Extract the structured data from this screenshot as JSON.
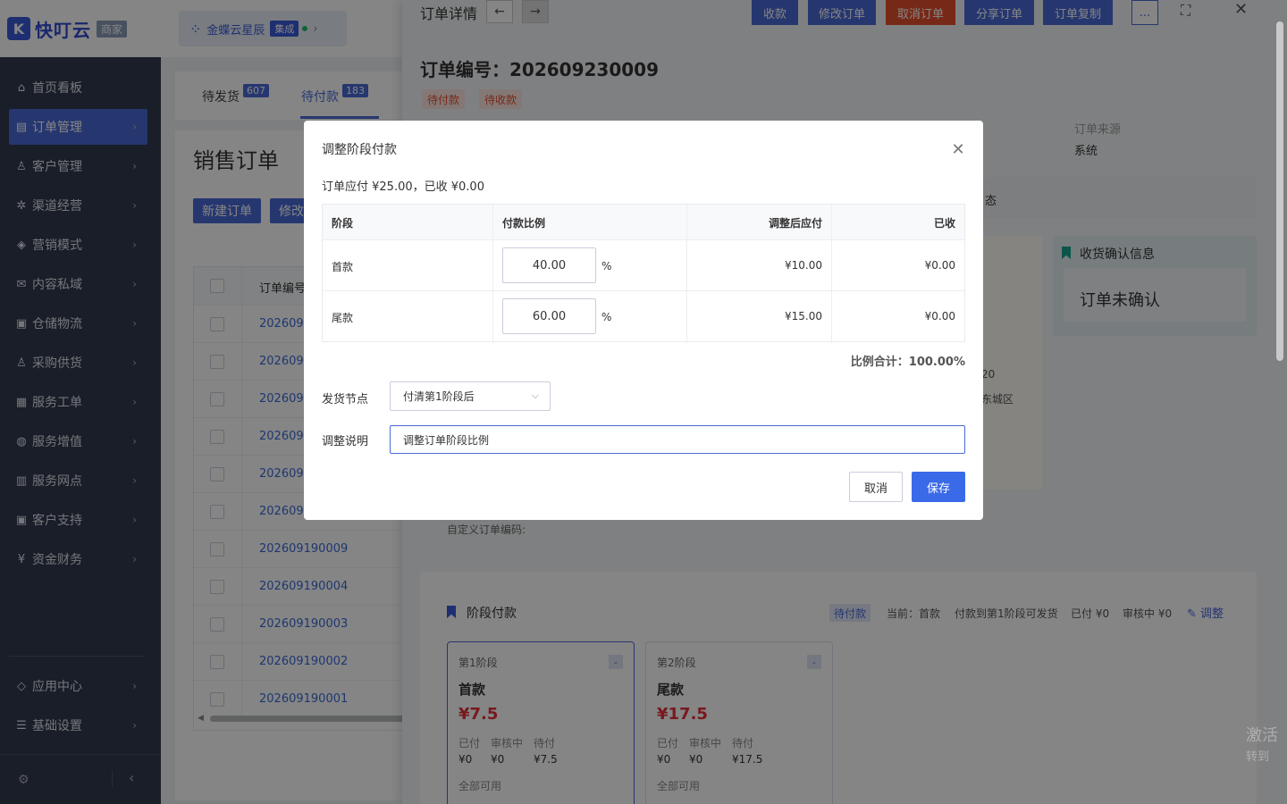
{
  "brand": {
    "name": "快叮云",
    "tag": "商家"
  },
  "tenant": {
    "name": "金蝶云星辰",
    "badge": "集成"
  },
  "sidebar": {
    "items": [
      {
        "label": "首页看板",
        "icon": "home-icon"
      },
      {
        "label": "订单管理",
        "icon": "order-icon",
        "active": true
      },
      {
        "label": "客户管理",
        "icon": "user-icon"
      },
      {
        "label": "渠道经营",
        "icon": "channel-icon"
      },
      {
        "label": "营销模式",
        "icon": "tag-icon"
      },
      {
        "label": "内容私域",
        "icon": "mail-icon"
      },
      {
        "label": "仓储物流",
        "icon": "warehouse-icon"
      },
      {
        "label": "采购供货",
        "icon": "purchase-icon"
      },
      {
        "label": "服务工单",
        "icon": "ticket-icon"
      },
      {
        "label": "服务增值",
        "icon": "bag-icon"
      },
      {
        "label": "服务网点",
        "icon": "store-icon"
      },
      {
        "label": "客户支持",
        "icon": "support-icon"
      },
      {
        "label": "资金财务",
        "icon": "yen-icon"
      }
    ],
    "bottom": [
      {
        "label": "应用中心",
        "icon": "cube-icon"
      },
      {
        "label": "基础设置",
        "icon": "settings-icon"
      }
    ]
  },
  "tabs": [
    {
      "label": "待发货",
      "count": "607"
    },
    {
      "label": "待付款",
      "count": "183"
    }
  ],
  "list": {
    "title": "销售订单",
    "new_button": "新建订单",
    "edit_button": "修改",
    "col_order_no": "订单编号",
    "rows": [
      "202609",
      "202609",
      "202609",
      "202609",
      "202609",
      "202609",
      "202609190009",
      "202609190004",
      "202609190003",
      "202609190002",
      "202609190001"
    ]
  },
  "drawer": {
    "title": "订单详情",
    "buttons": {
      "collect": "收款",
      "edit": "修改订单",
      "cancel": "取消订单",
      "share": "分享订单",
      "copy": "订单复制",
      "more": "..."
    },
    "order_no": "订单编号：202609230009",
    "tags": [
      "待付款",
      "待收款"
    ],
    "source_label": "订单来源",
    "source_value": "系统",
    "log_partial": "态",
    "addr_partial_1": "20",
    "addr_partial_2": "东城区",
    "confirm_title": "收货确认信息",
    "confirm_value": "订单未确认",
    "custom_code_label": "自定义订单编码:",
    "stage_title": "阶段付款",
    "stage_status": "待付款",
    "stage_current": "当前：首款",
    "stage_rule": "付款到第1阶段可发货",
    "stage_paid": "已付 ¥0",
    "stage_review": "审核中 ¥0",
    "stage_adjust": "调整",
    "stages": [
      {
        "no": "第1阶段",
        "name": "首款",
        "amount": "¥7.5",
        "paid": "¥0",
        "review": "¥0",
        "pending": "¥7.5",
        "avail": "全部可用"
      },
      {
        "no": "第2阶段",
        "name": "尾款",
        "amount": "¥17.5",
        "paid": "¥0",
        "review": "¥0",
        "pending": "¥17.5",
        "avail": "全部可用"
      }
    ],
    "labels": {
      "paid": "已付",
      "review": "审核中",
      "pending": "待付",
      "minus": "-"
    }
  },
  "modal": {
    "title": "调整阶段付款",
    "summary": "订单应付 ¥25.00，已收 ¥0.00",
    "headers": {
      "stage": "阶段",
      "ratio": "付款比例",
      "adjusted": "调整后应付",
      "received": "已收"
    },
    "rows": [
      {
        "stage": "首款",
        "ratio": "40.00",
        "unit": "%",
        "adjusted": "¥10.00",
        "received": "¥0.00"
      },
      {
        "stage": "尾款",
        "ratio": "60.00",
        "unit": "%",
        "adjusted": "¥15.00",
        "received": "¥0.00"
      }
    ],
    "total": "比例合计：100.00%",
    "ship_label": "发货节点",
    "ship_value": "付清第1阶段后",
    "note_label": "调整说明",
    "note_value": "调整订单阶段比例",
    "cancel": "取消",
    "save": "保存"
  },
  "watermark": {
    "line1": "激活",
    "line2": "转到"
  }
}
